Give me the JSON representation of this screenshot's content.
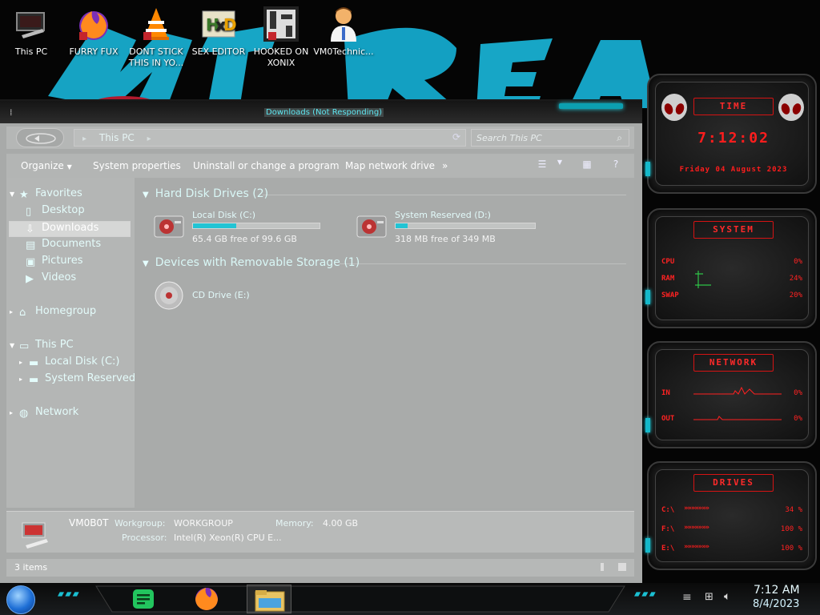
{
  "desktop": {
    "icons": [
      {
        "label": "This PC",
        "icon": "computer-icon"
      },
      {
        "label": "FURRY FUX",
        "icon": "firefox-icon"
      },
      {
        "label": "DONT STICK THIS IN YO...",
        "icon": "vlc-icon"
      },
      {
        "label": "SEX EDITOR",
        "icon": "hxd-icon"
      },
      {
        "label": "HOOKED ON XONIX",
        "icon": "game-icon"
      },
      {
        "label": "VM0Technic...",
        "icon": "doctor-icon"
      }
    ]
  },
  "explorer": {
    "title": "Downloads (Not Responding)",
    "breadcrumb": "This PC",
    "search_placeholder": "Search This PC",
    "toolbar": {
      "organize": "Organize",
      "system_properties": "System properties",
      "uninstall": "Uninstall or change a program",
      "map_drive": "Map network drive",
      "more": "»"
    },
    "nav": {
      "favorites": "Favorites",
      "desktop": "Desktop",
      "downloads": "Downloads",
      "documents": "Documents",
      "pictures": "Pictures",
      "videos": "Videos",
      "homegroup": "Homegroup",
      "this_pc": "This PC",
      "local_disk": "Local Disk (C:)",
      "system_reserved": "System Reserved",
      "network": "Network"
    },
    "groups": {
      "hard_disks": "Hard Disk Drives (2)",
      "removable": "Devices with Removable Storage (1)"
    },
    "drives": [
      {
        "name": "Local Disk (C:)",
        "free": "65.4 GB free of 99.6 GB",
        "used_fraction": 0.343
      },
      {
        "name": "System Reserved (D:)",
        "free": "318 MB free of 349 MB",
        "used_fraction": 0.089
      }
    ],
    "removable": [
      {
        "name": "CD Drive (E:)"
      }
    ],
    "details": {
      "computer_name": "VM0B0T",
      "workgroup_label": "Workgroup:",
      "workgroup_value": "WORKGROUP",
      "memory_label": "Memory:",
      "memory_value": "4.00 GB",
      "processor_label": "Processor:",
      "processor_value": "Intel(R) Xeon(R) CPU E..."
    },
    "status": {
      "items": "3 items"
    }
  },
  "gadgets": {
    "time": {
      "header": "TIME",
      "clock": "7:12:02",
      "date": "Friday 04 August 2023"
    },
    "system": {
      "header": "SYSTEM",
      "rows": [
        {
          "label": "CPU",
          "value": "0%"
        },
        {
          "label": "RAM",
          "value": "24%"
        },
        {
          "label": "SWAP",
          "value": "20%"
        }
      ]
    },
    "network": {
      "header": "NETWORK",
      "rows": [
        {
          "label": "IN",
          "value": "0%"
        },
        {
          "label": "OUT",
          "value": "0%"
        }
      ]
    },
    "drives": {
      "header": "DRIVES",
      "rows": [
        {
          "label": "C:\\",
          "value": "34 %"
        },
        {
          "label": "F:\\",
          "value": "100 %"
        },
        {
          "label": "E:\\",
          "value": "100 %"
        }
      ]
    }
  },
  "taskbar": {
    "apps": [
      {
        "name": "notes-app-icon"
      },
      {
        "name": "firefox-icon"
      },
      {
        "name": "file-explorer-icon",
        "active": true
      }
    ],
    "clock": {
      "time": "7:12 AM",
      "date": "8/4/2023"
    }
  },
  "colors": {
    "accent_cyan": "#22c4d4",
    "gadget_red": "#ff1d1d",
    "explorer_bg": "#a8aaa9"
  }
}
